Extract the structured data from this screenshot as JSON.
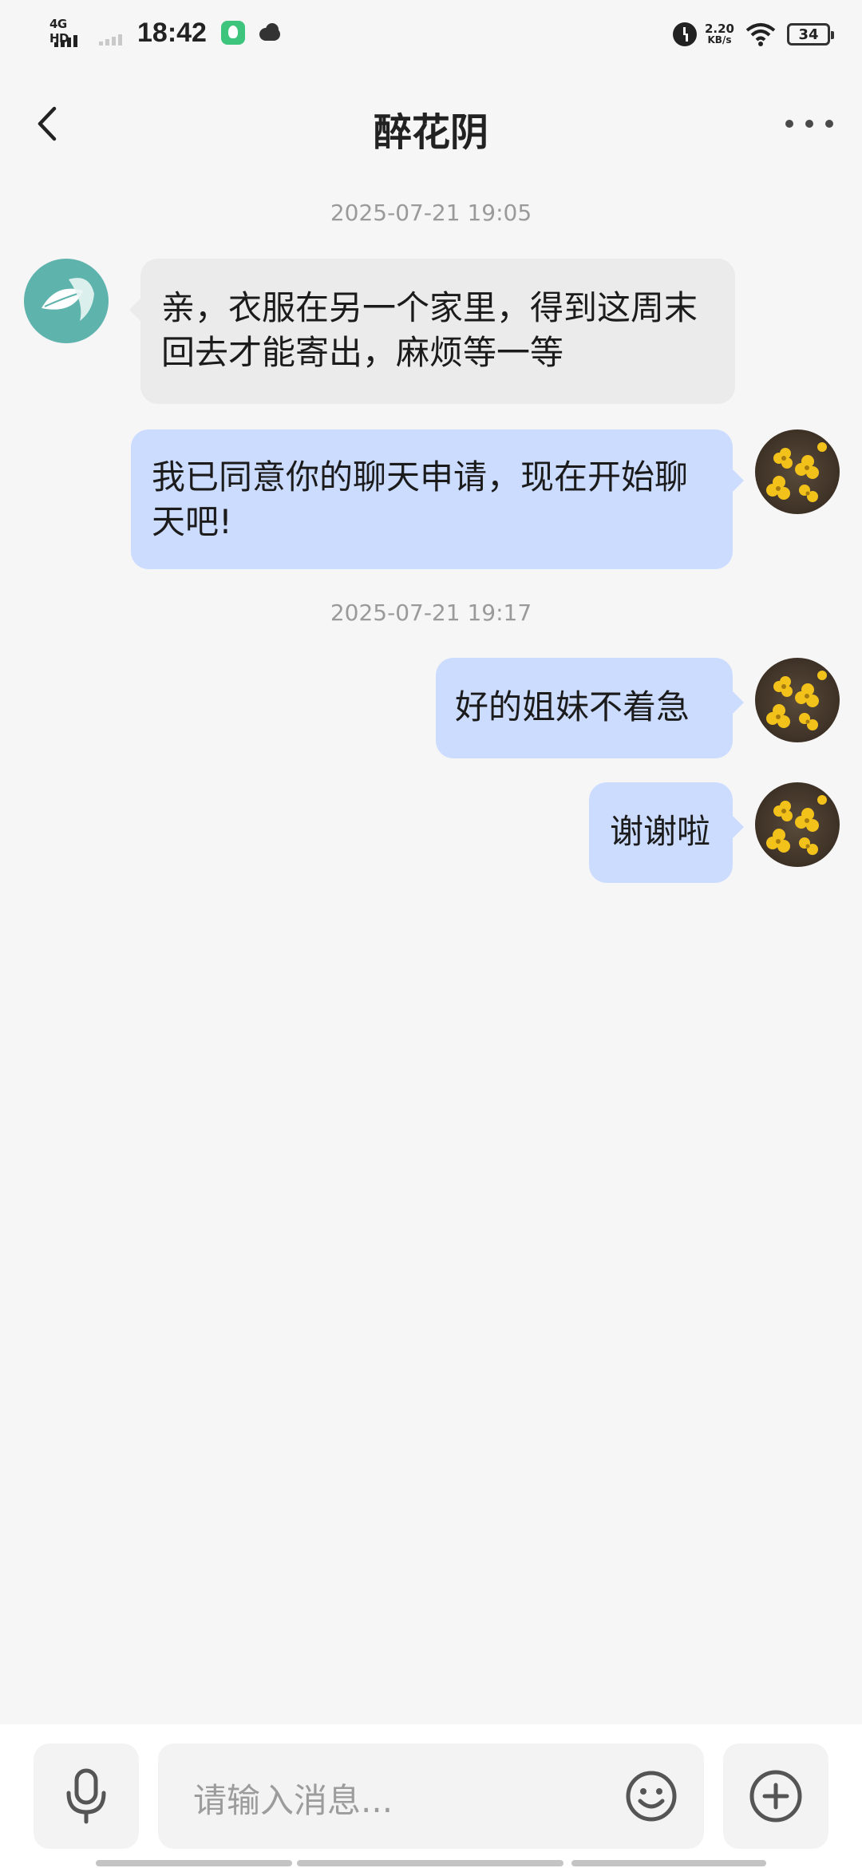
{
  "status_bar": {
    "network": "4G HD",
    "time": "18:42",
    "speed_value": "2.20",
    "speed_unit": "KB/s",
    "battery": "34",
    "icons": [
      "signal-icon",
      "signal-secondary-icon",
      "app-leaf-icon",
      "cloud-icon",
      "alarm-icon",
      "wifi-icon",
      "battery-icon"
    ]
  },
  "header": {
    "title": "醉花阴",
    "back_icon": "chevron-left-icon",
    "more_icon": "more-horizontal-icon"
  },
  "messages": [
    {
      "type": "timestamp",
      "text": "2025-07-21  19:05"
    },
    {
      "type": "message",
      "from": "other",
      "avatar": "teal-leaf-avatar",
      "text": "亲，衣服在另一个家里，得到这周末回去才能寄出，麻烦等一等"
    },
    {
      "type": "message",
      "from": "me",
      "avatar": "yellow-flower-avatar",
      "text": "我已同意你的聊天申请，现在开始聊天吧!"
    },
    {
      "type": "timestamp",
      "text": "2025-07-21  19:17"
    },
    {
      "type": "message",
      "from": "me",
      "avatar": "yellow-flower-avatar",
      "text": "好的姐妹不着急"
    },
    {
      "type": "message",
      "from": "me",
      "avatar": "yellow-flower-avatar",
      "text": "谢谢啦"
    }
  ],
  "input_bar": {
    "placeholder": "请输入消息...",
    "voice_icon": "microphone-icon",
    "emoji_icon": "emoji-icon",
    "plus_icon": "plus-circle-icon"
  },
  "colors": {
    "background": "#f6f6f7",
    "incoming_bubble": "#ebebeb",
    "outgoing_bubble": "#ccdcff",
    "timestamp": "#9a9a9a",
    "avatar_teal": "#5fb3ad"
  }
}
